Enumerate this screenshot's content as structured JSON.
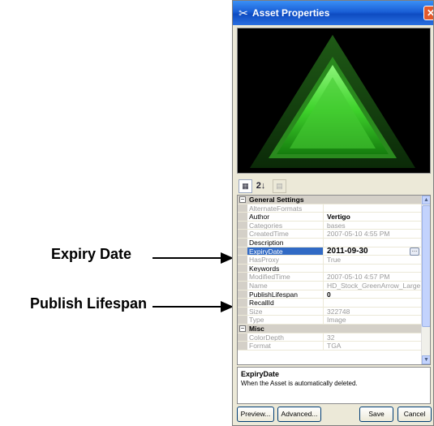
{
  "callouts": [
    {
      "label": "Expiry Date"
    },
    {
      "label": "Publish Lifespan"
    }
  ],
  "window": {
    "title": "Asset Properties",
    "title_icon": "tools-icon",
    "close_label": "✕"
  },
  "toolbar": {
    "alpha_label": "2↓"
  },
  "grid": {
    "categories": {
      "general": "General Settings",
      "misc": "Misc"
    },
    "general_rows": [
      {
        "name": "AlternateFormats",
        "value": "",
        "editable": false
      },
      {
        "name": "Author",
        "value": "Vertigo",
        "editable": true,
        "bold": true
      },
      {
        "name": "Categories",
        "value": "bases",
        "editable": false
      },
      {
        "name": "CreatedTime",
        "value": "2007-05-10 4:55 PM",
        "editable": false
      },
      {
        "name": "Description",
        "value": "",
        "editable": true
      },
      {
        "name": "ExpiryDate",
        "value": "2011-09-30",
        "editable": true,
        "selected": true
      },
      {
        "name": "HasProxy",
        "value": "True",
        "editable": false
      },
      {
        "name": "Keywords",
        "value": "",
        "editable": true
      },
      {
        "name": "ModifiedTime",
        "value": "2007-05-10 4:57 PM",
        "editable": false
      },
      {
        "name": "Name",
        "value": "HD_Stock_GreenArrow_Large",
        "editable": false
      },
      {
        "name": "PublishLifespan",
        "value": "0",
        "editable": true,
        "bold": true
      },
      {
        "name": "RecallId",
        "value": "",
        "editable": true
      },
      {
        "name": "Size",
        "value": "322748",
        "editable": false
      },
      {
        "name": "Type",
        "value": "Image",
        "editable": false
      }
    ],
    "misc_rows": [
      {
        "name": "ColorDepth",
        "value": "32",
        "editable": false
      },
      {
        "name": "Format",
        "value": "TGA",
        "editable": false
      }
    ]
  },
  "help": {
    "title": "ExpiryDate",
    "description": "When the Asset is automatically deleted."
  },
  "buttons": {
    "preview": "Preview...",
    "advanced": "Advanced...",
    "save": "Save",
    "cancel": "Cancel"
  },
  "colors": {
    "titlebar": "#1a5fd6",
    "selection": "#316ac5",
    "arrow_green": "#4cdc3a"
  }
}
